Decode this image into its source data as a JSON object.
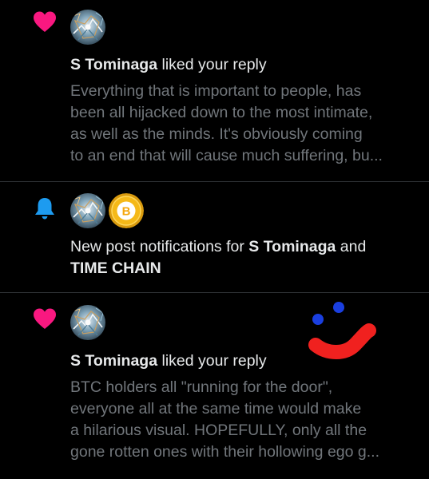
{
  "notifications": [
    {
      "kind": "like",
      "icon": "heart-icon",
      "icon_color": "#f91880",
      "actor": "S Tominaga",
      "action": " liked your reply",
      "snippet_lines": [
        "Everything that is important to people, has",
        "been all hijacked down to the most intimate,",
        "as well as the minds. It's obviously coming",
        "to an end that will cause much suffering, bu..."
      ]
    },
    {
      "kind": "new-post-subscription",
      "icon": "bell-icon",
      "icon_color": "#1d9bf0",
      "text_prefix": "New post notifications for ",
      "actor_1": "S Tominaga",
      "joiner": " and",
      "actor_2": "TIME CHAIN",
      "coin_glyph": "B",
      "coin_color": "#f5b918"
    },
    {
      "kind": "like",
      "icon": "heart-icon",
      "icon_color": "#f91880",
      "actor": "S Tominaga",
      "action": " liked your reply",
      "snippet_lines": [
        "BTC holders all \"running for the door\",",
        "everyone all at the same time would make",
        "a hilarious visual. HOPEFULLY, only all the",
        "gone rotten ones with their hollowing ego g..."
      ]
    }
  ],
  "overlay": {
    "doodle": "smiley-face-doodle",
    "eye_color": "#1a3fe0",
    "mouth_color": "#f0211f"
  }
}
